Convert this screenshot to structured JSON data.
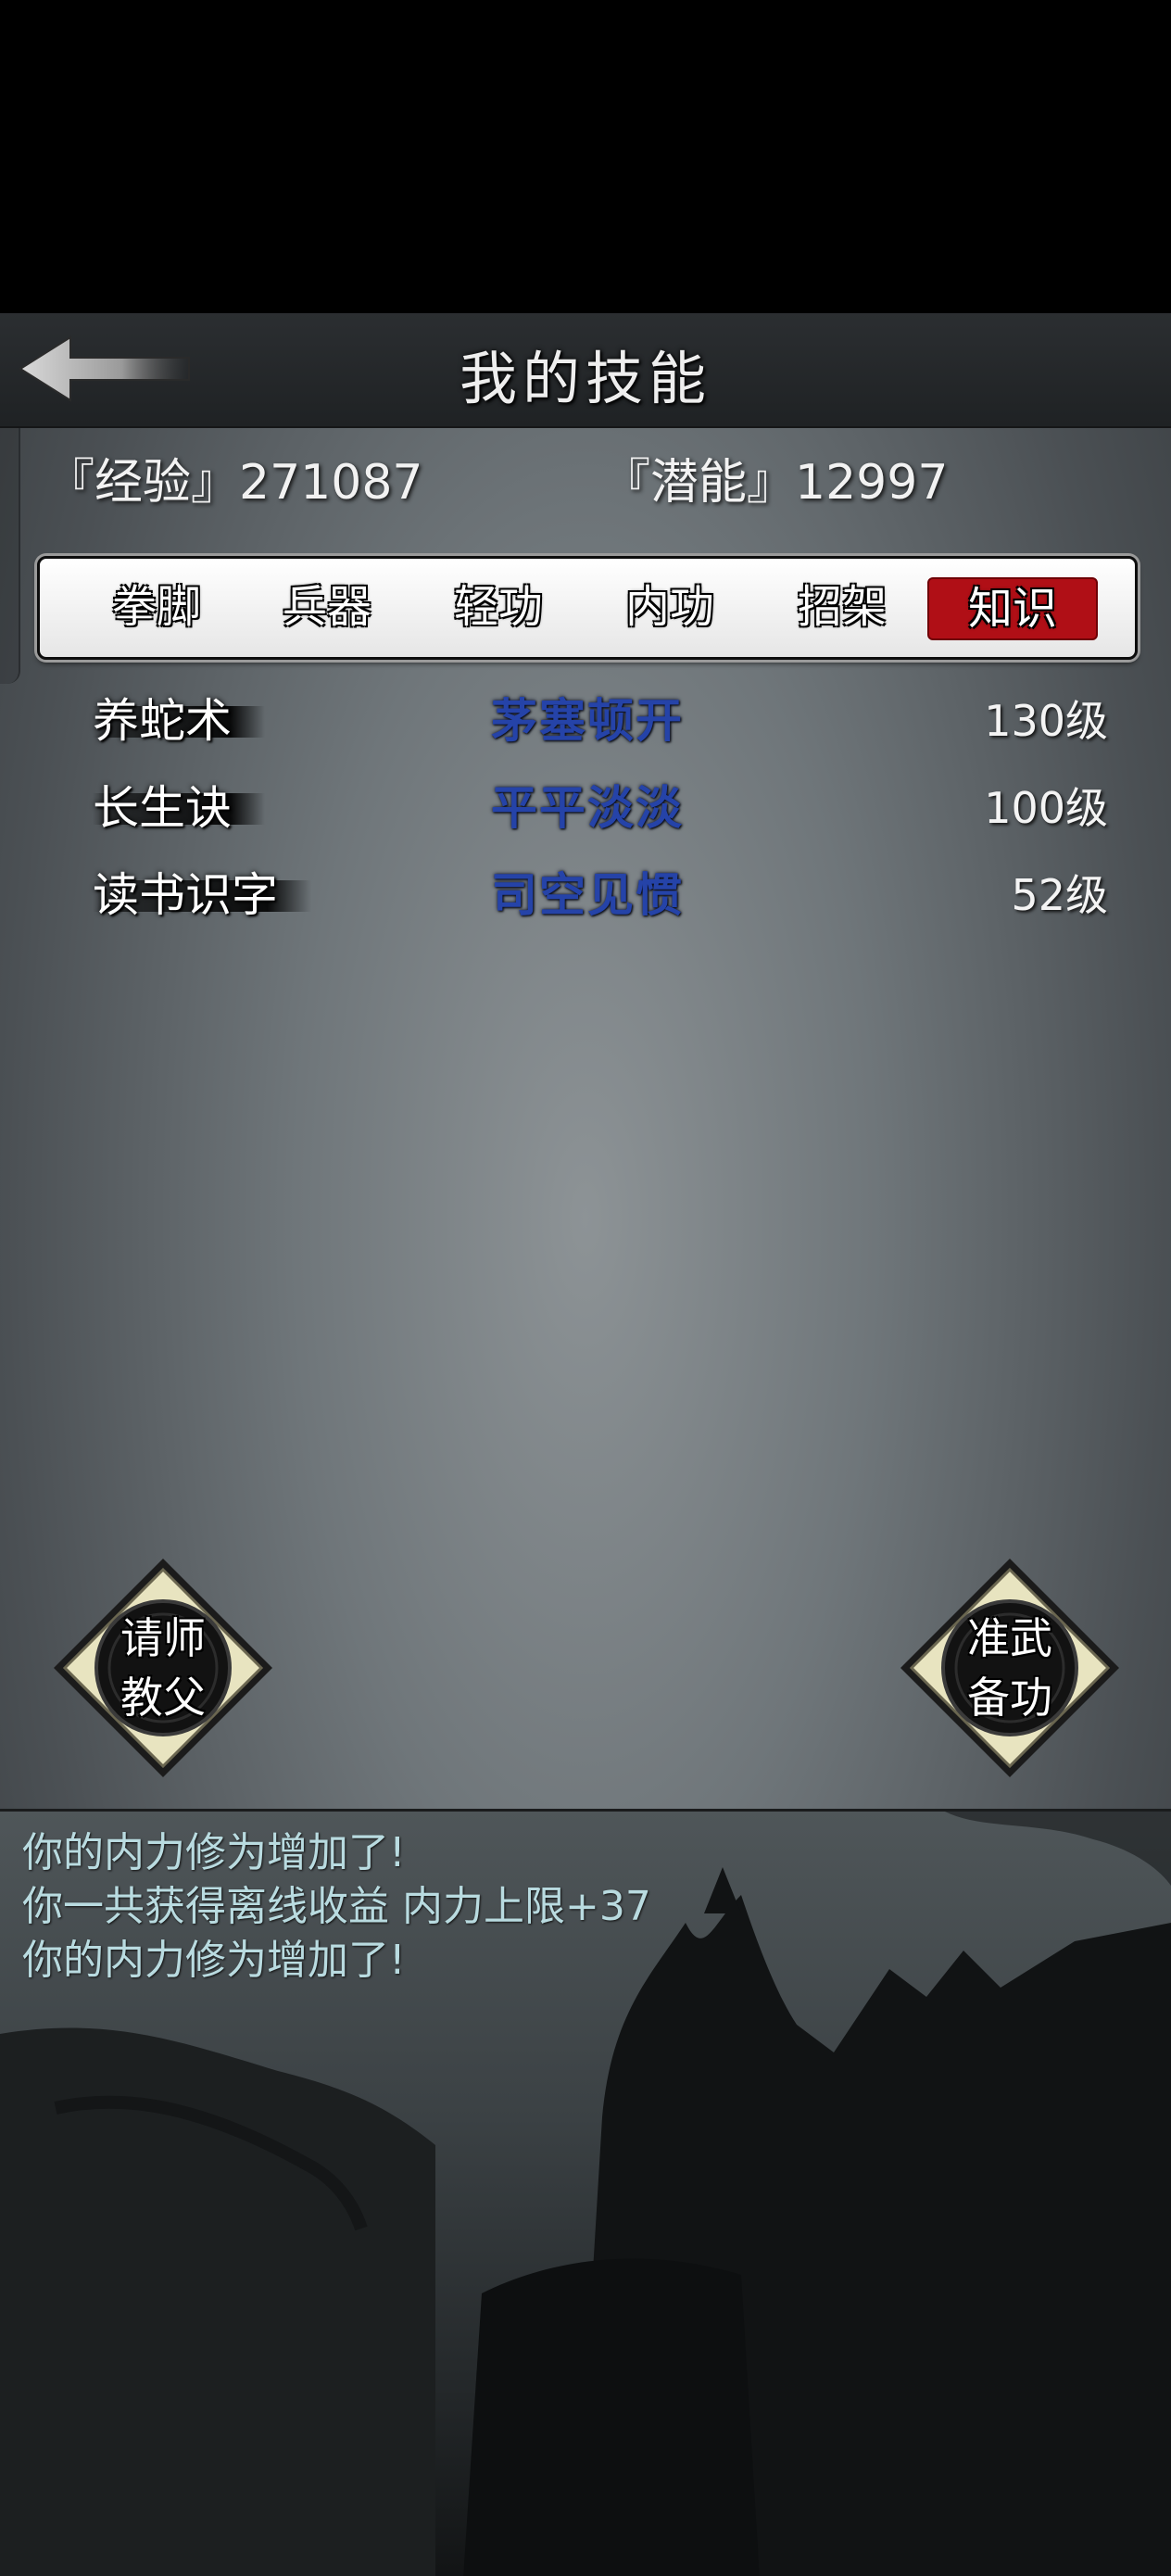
{
  "header": {
    "title": "我的技能",
    "back_icon": "back-arrow-icon"
  },
  "stats": {
    "experience_label": "『经验』271087",
    "potential_label": "『潜能』12997"
  },
  "tabs": [
    {
      "label": "拳脚",
      "active": false
    },
    {
      "label": "兵器",
      "active": false
    },
    {
      "label": "轻功",
      "active": false
    },
    {
      "label": "内功",
      "active": false
    },
    {
      "label": "招架",
      "active": false
    },
    {
      "label": "知识",
      "active": true
    }
  ],
  "skills": [
    {
      "name": "养蛇术",
      "rank": "茅塞顿开",
      "level": "130级"
    },
    {
      "name": "长生诀",
      "rank": "平平淡淡",
      "level": "100级"
    },
    {
      "name": "读书识字",
      "rank": "司空见惯",
      "level": "52级"
    }
  ],
  "actions": {
    "ask_master": {
      "line1": "请师",
      "line2": "教父"
    },
    "prepare_skill": {
      "line1": "准武",
      "line2": "备功"
    }
  },
  "log": [
    "你的内力修为增加了!",
    "你一共获得离线收益 内力上限+37",
    "你的内力修为增加了!"
  ],
  "colors": {
    "active_tab": "#b00f16",
    "rank_text": "#2543a8",
    "log_text": "#b9dbe0"
  }
}
